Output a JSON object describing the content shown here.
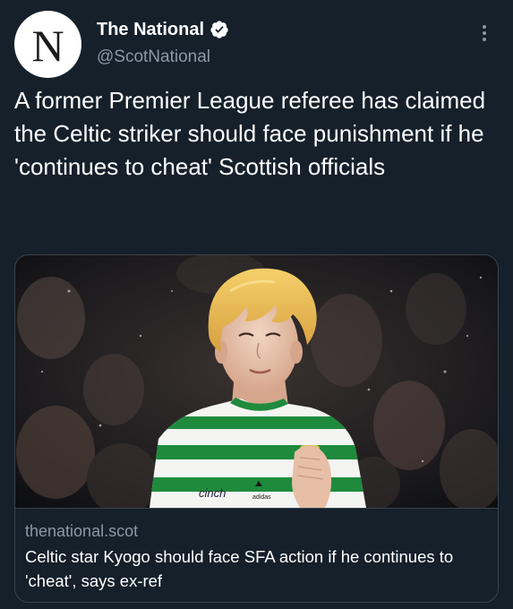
{
  "account": {
    "avatar_letter": "N",
    "display_name": "The National",
    "verified": true,
    "handle": "@ScotNational"
  },
  "tweet": {
    "text": "A former Premier League referee has claimed the Celtic striker should face punishment if he 'continues to cheat' Scottish officials"
  },
  "card": {
    "image_subject": "Celtic striker with bleached blond hair in green-and-white hooped kit, hand on chest, crowd blurred behind",
    "image_kit_text": "cinch",
    "image_brand_text": "adidas",
    "domain": "thenational.scot",
    "title": "Celtic star Kyogo should face SFA action if he continues to 'cheat', says ex-ref"
  },
  "colors": {
    "background": "#15202b",
    "border": "#38444d",
    "secondary_text": "#8b98a5",
    "verified_badge": "#ffffff",
    "kit_green": "#1f8a3c"
  }
}
